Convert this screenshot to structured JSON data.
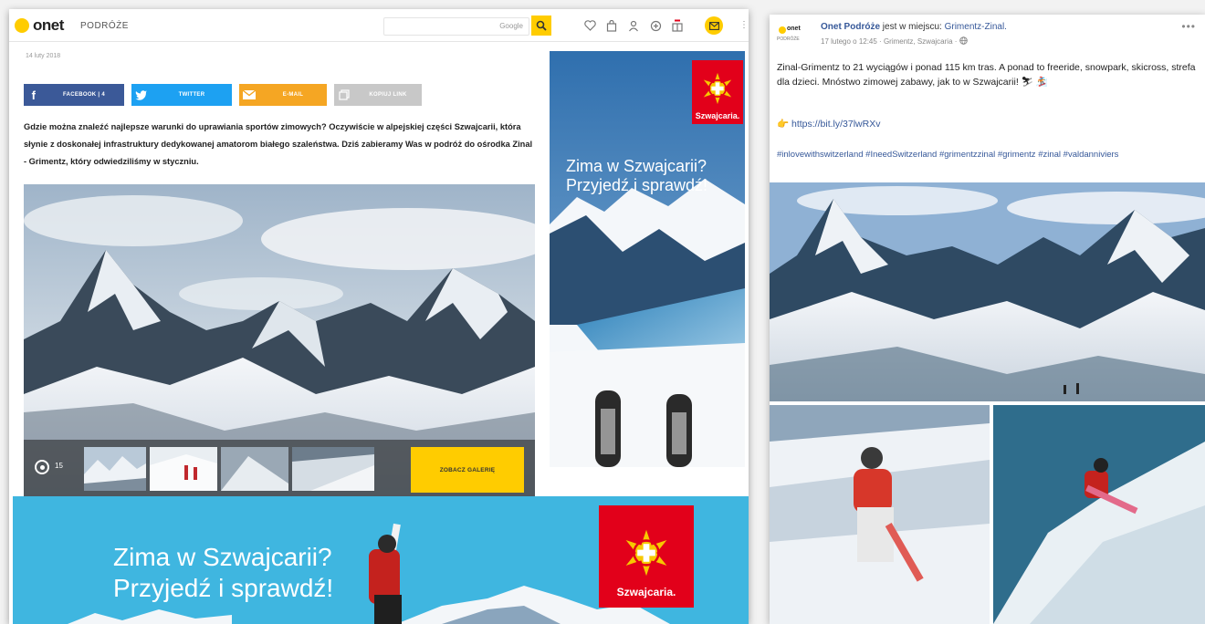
{
  "onet": {
    "logo_text": "onet",
    "section_label": "PODRÓŻE",
    "search": {
      "provider": "Google"
    },
    "date": "14 luty 2018",
    "share": {
      "facebook": "FACEBOOK | 4",
      "twitter": "TWITTER",
      "email": "E-MAIL",
      "copy": "KOPIUJ LINK"
    },
    "lead": "Gdzie można znaleźć najlepsze warunki do uprawiania sportów zimowych? Oczywiście w alpejskiej części Szwajcarii, która słynie z doskonałej infrastruktury dedykowanej amatorom białego szaleństwa. Dziś zabieramy Was w podróż do ośrodka Zinal - Grimentz, który odwiedziliśmy w styczniu.",
    "gallery": {
      "photo_count": "15",
      "button": "ZOBACZ GALERIĘ"
    },
    "ad_side": {
      "brand": "Szwajcaria.",
      "line1": "Zima w Szwajcarii?",
      "line2": "Przyjedź i sprawdź!"
    },
    "ad_bottom": {
      "brand": "Szwajcaria.",
      "line1": "Zima w Szwajcarii?",
      "line2": "Przyjedź i sprawdź!"
    }
  },
  "facebook": {
    "logo_text": "onet",
    "logo_sub": "PODRÓŻE",
    "page_name": "Onet Podróże",
    "header_middle": "jest w miejscu:",
    "location": "Grimentz-Zinal.",
    "meta": "17 lutego o 12:45 · Grimentz, Szwajcaria ·",
    "body": "Zinal-Grimentz to 21 wyciągów i ponad 115 km tras. A ponad to freeride, snowpark, skicross, strefa dla dzieci. Mnóstwo zimowej zabawy, jak to w Szwajcarii! ⛷ 🏂",
    "link": "https://bit.ly/37lwRXv",
    "tags": "#inlovewithswitzerland #IneedSwitzerland #grimentzzinal #grimentz #zinal #valdanniviers"
  },
  "colors": {
    "onet_yellow": "#ffcc00",
    "facebook_blue": "#3b5998",
    "twitter_blue": "#1da1f2",
    "email_orange": "#f5a623",
    "swiss_red": "#e2001a",
    "fb_link": "#365899"
  },
  "icons": [
    "search-icon",
    "heart-icon",
    "bag-icon",
    "user-icon",
    "plus-circle-icon",
    "gift-icon",
    "mail-icon",
    "camera-icon",
    "globe-icon",
    "more-icon"
  ]
}
